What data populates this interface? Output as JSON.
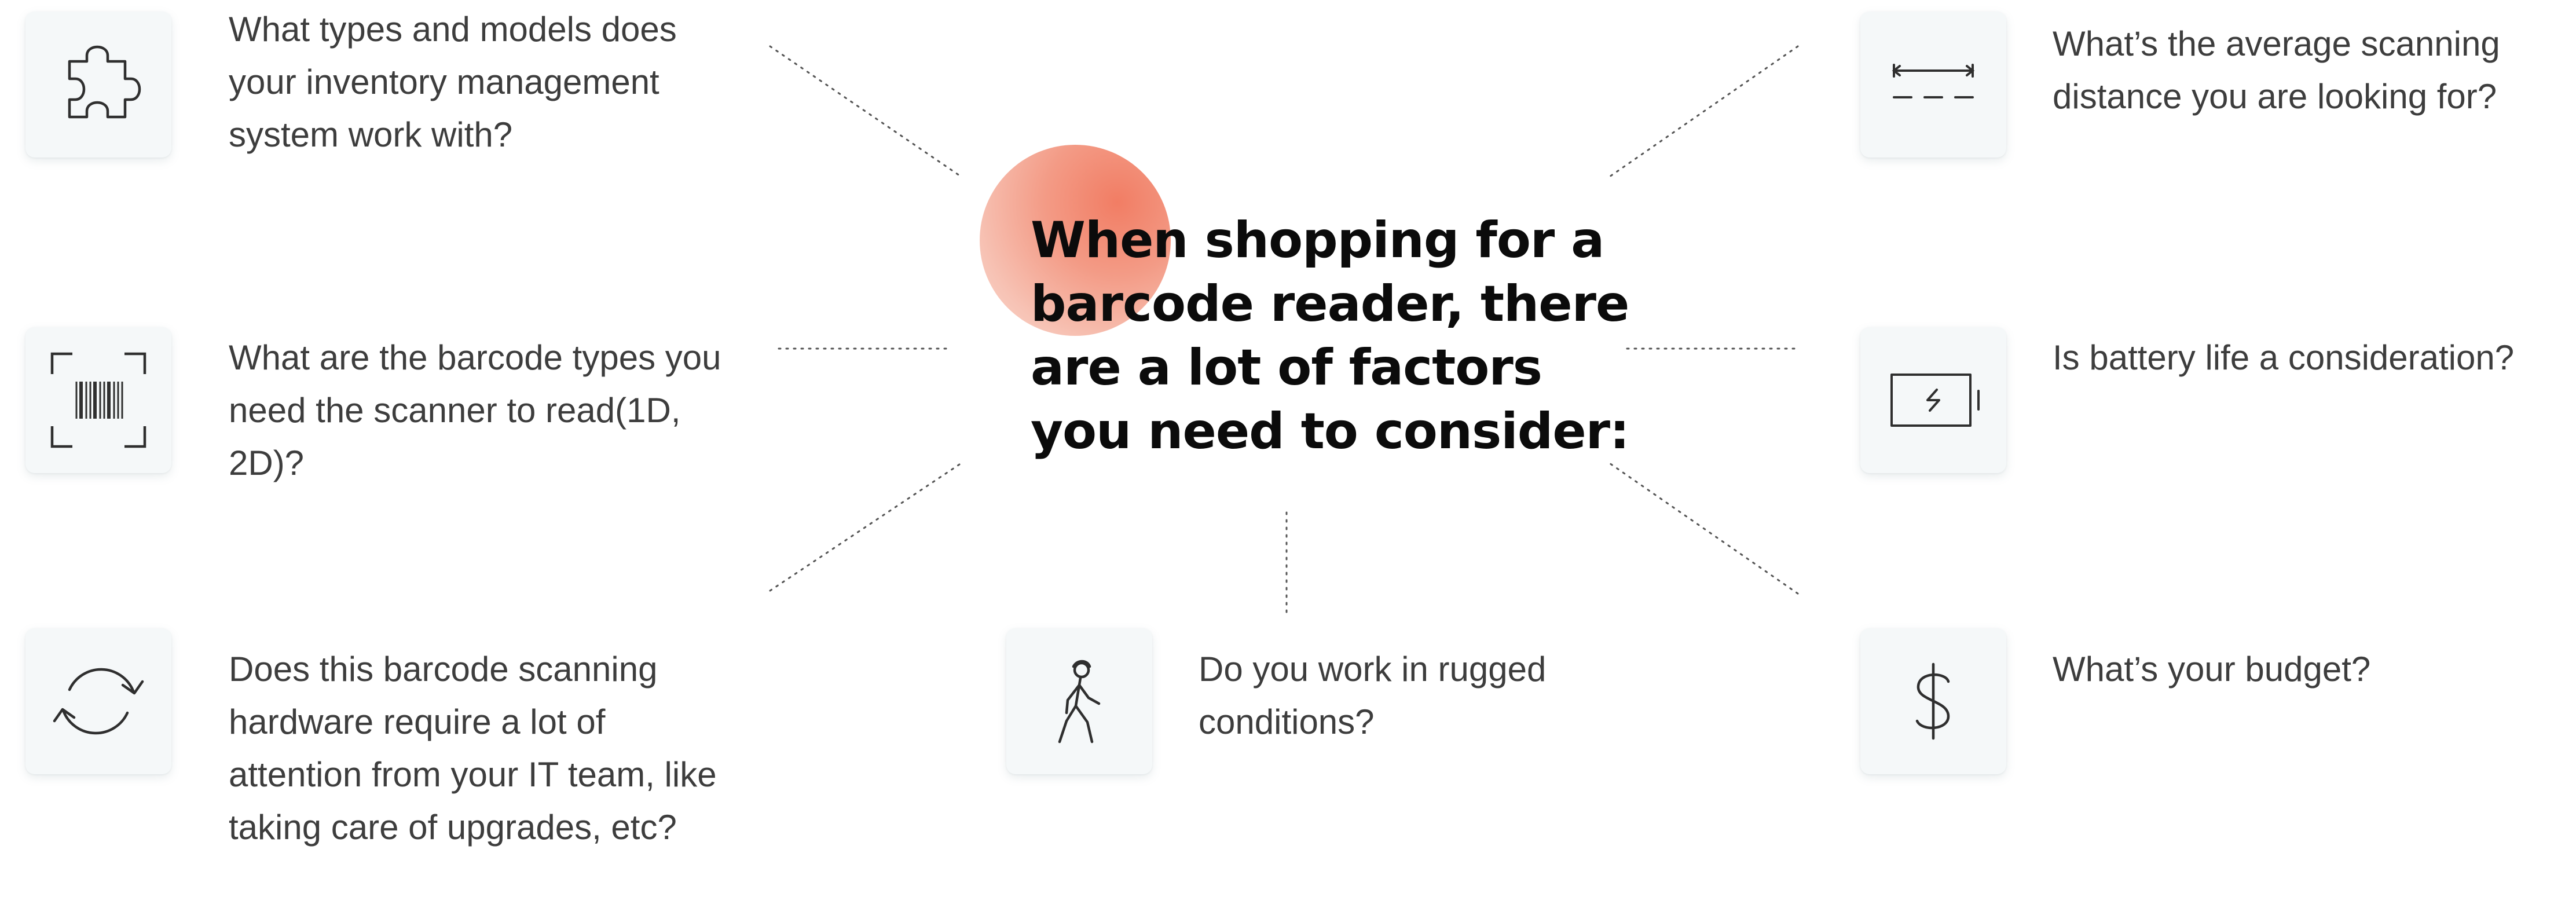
{
  "heading": "When shopping for a barcode reader, there are a lot of factors you need to consider:",
  "factors": [
    {
      "icon": "puzzle-piece-icon",
      "text": "What types and models does your inventory management system work with?"
    },
    {
      "icon": "barcode-scan-icon",
      "text": "What are the barcode types you need the scanner to read(1D, 2D)?"
    },
    {
      "icon": "refresh-cycle-icon",
      "text": "Does this barcode scanning hardware require a lot of attention from your IT team, like taking care of upgrades, etc?"
    },
    {
      "icon": "rugged-walker-icon",
      "text": "Do you work in rugged conditions?"
    },
    {
      "icon": "distance-measure-icon",
      "text": "What’s the average scanning distance you are looking for?"
    },
    {
      "icon": "battery-charge-icon",
      "text": "Is battery life a consideration?"
    },
    {
      "icon": "dollar-sign-icon",
      "text": "What’s your budget?"
    }
  ],
  "colors": {
    "accent": "#f27d64",
    "card": "#f5f8f9",
    "text": "#3d3d3d",
    "heading": "#0b0b0b",
    "line": "#555555"
  }
}
